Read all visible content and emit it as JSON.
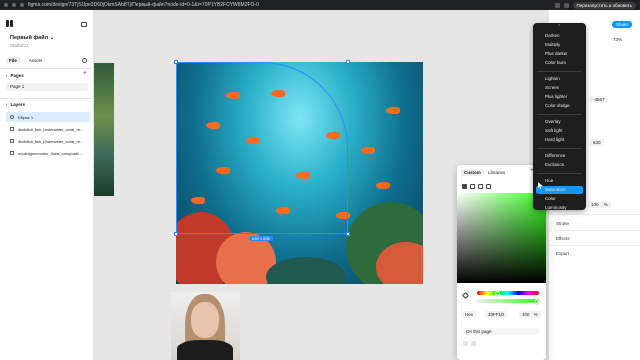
{
  "browser": {
    "url": "figma.com/design/73TjSUpe3D60jOkmSAb8Tj/Первый-файл?node-id=0-1&t=70P1YB2FCYW8M2FO-0",
    "update_label": "Перезапустить и обновить"
  },
  "left_panel": {
    "file_name": "Первый файл",
    "file_chevron": "⌄",
    "team": "Starbizzz",
    "tabs": [
      "File",
      "Assets"
    ],
    "pages_label": "Pages",
    "pages": [
      "Page 1"
    ],
    "layers_label": "Layers",
    "layers": [
      "Ellipse 1",
      "dkdldkdl_fish_underwater_coral_re...",
      "dkdldkdl_fish_underwater_coral_re...",
      "orpdragonmoohe_floral_compositi..."
    ]
  },
  "canvas": {
    "selection_size": "630 × 630"
  },
  "top_right": {
    "share_label": "Share",
    "zoom": "73%"
  },
  "properties": {
    "y_value": "-4567",
    "size_value": "630",
    "opacity_value": "100",
    "opacity_unit": "%",
    "sections": [
      "Stroke",
      "Effects",
      "Export"
    ]
  },
  "blend_modes": {
    "groups": [
      [
        "Darken",
        "Multiply",
        "Plus darker",
        "Color burn"
      ],
      [
        "Lighten",
        "Screen",
        "Plus lighter",
        "Color dodge"
      ],
      [
        "Overlay",
        "Soft light",
        "Hard light"
      ],
      [
        "Difference",
        "Exclusion"
      ],
      [
        "Hue",
        "Saturation",
        "Color",
        "Luminosity"
      ]
    ],
    "selected": "Saturation"
  },
  "color_picker": {
    "tabs": [
      "Custom",
      "Libraries"
    ],
    "format": "Hex",
    "hex": "33FF1D",
    "alpha": "100",
    "alpha_unit": "%",
    "scope": "On this page",
    "hue_position": 0.33,
    "alpha_position": 1.0,
    "colors": {
      "selected": "#33FF1D",
      "accent": "#0D99FF"
    }
  }
}
